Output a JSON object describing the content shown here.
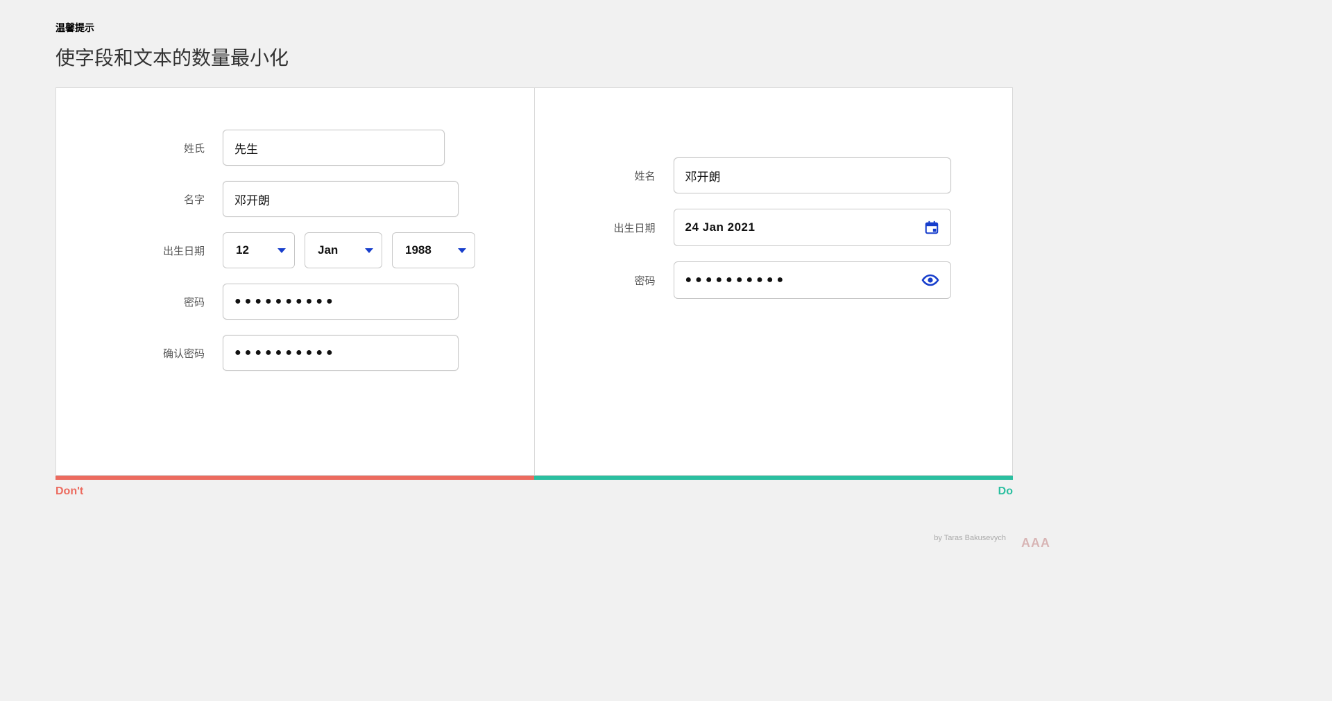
{
  "header": {
    "tip_label": "温馨提示",
    "headline": "使字段和文本的数量最小化"
  },
  "dont_panel": {
    "tag": "Don't",
    "fields": {
      "surname_label": "姓氏",
      "surname_value": "先生",
      "given_label": "名字",
      "given_value": "邓开朗",
      "dob_label": "出生日期",
      "dob_day": "12",
      "dob_month": "Jan",
      "dob_year": "1988",
      "password_label": "密码",
      "password_mask": "●●●●●●●●●●",
      "confirm_label": "确认密码",
      "confirm_mask": "●●●●●●●●●●"
    }
  },
  "do_panel": {
    "tag": "Do",
    "fields": {
      "name_label": "姓名",
      "name_value": "邓开朗",
      "dob_label": "出生日期",
      "dob_value": "24 Jan 2021",
      "password_label": "密码",
      "password_mask": "●●●●●●●●●●"
    }
  },
  "footer": {
    "credit": "by Taras Bakusevych",
    "watermark": "AAA"
  },
  "colors": {
    "dont": "#ec6b5f",
    "do": "#2bbfa0",
    "accent": "#173ecc"
  }
}
